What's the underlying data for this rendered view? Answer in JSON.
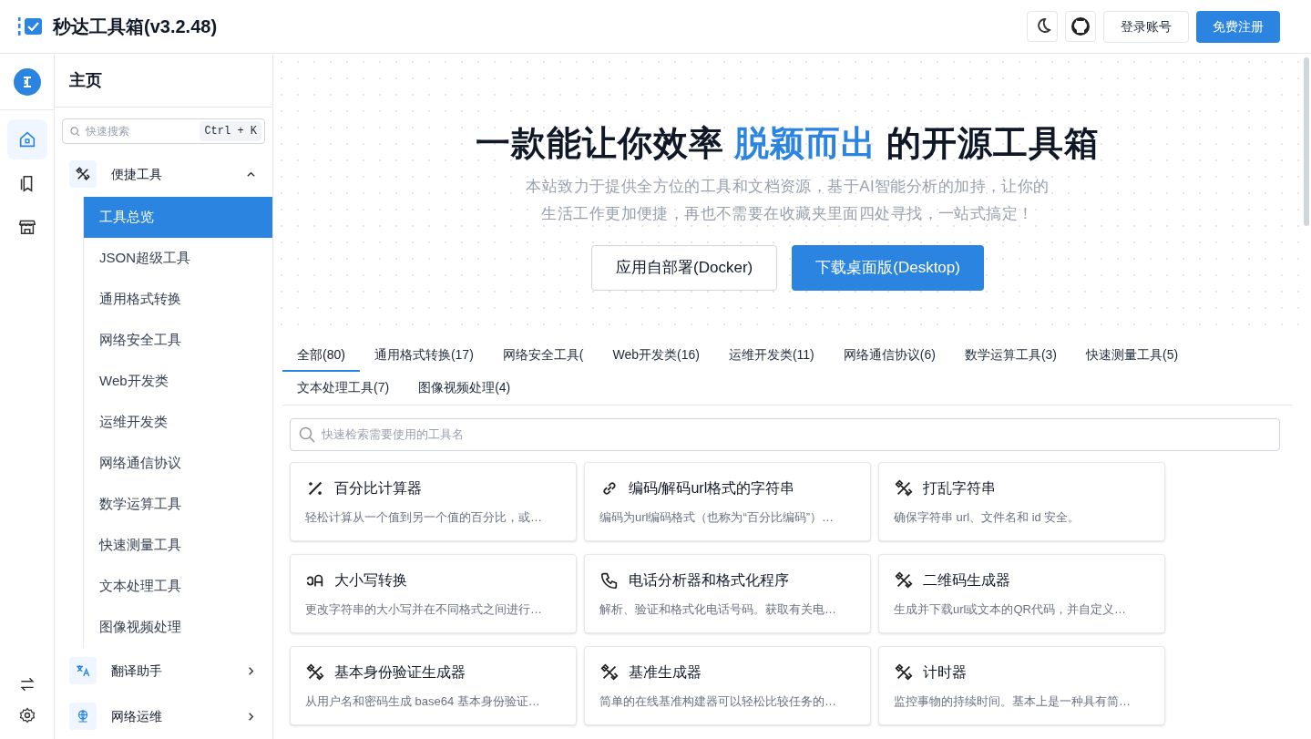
{
  "header": {
    "title": "秒达工具箱(v3.2.48)",
    "buttons": [
      {
        "kind": "theme"
      },
      {
        "kind": "github"
      },
      {
        "kind": "login",
        "label": "登录账号"
      },
      {
        "kind": "signup",
        "label": "免费注册"
      }
    ]
  },
  "rail": {
    "items": [
      {
        "kind": "home",
        "selected": true
      },
      {
        "kind": "bookmark",
        "selected": false
      },
      {
        "kind": "store",
        "selected": false
      }
    ],
    "bottom": [
      {
        "kind": "swap"
      },
      {
        "kind": "settings"
      }
    ]
  },
  "sidebar": {
    "title": "主页",
    "search": {
      "placeholder": "快速搜索",
      "shortcut": "Ctrl + K"
    },
    "groups": [
      {
        "label": "便捷工具",
        "kind": "tools",
        "expanded": true,
        "children": [
          {
            "label": "工具总览",
            "selected": true
          },
          {
            "label": "JSON超级工具",
            "selected": false
          },
          {
            "label": "通用格式转换",
            "selected": false
          },
          {
            "label": "网络安全工具",
            "selected": false
          },
          {
            "label": "Web开发类",
            "selected": false
          },
          {
            "label": "运维开发类",
            "selected": false
          },
          {
            "label": "网络通信协议",
            "selected": false
          },
          {
            "label": "数学运算工具",
            "selected": false
          },
          {
            "label": "快速测量工具",
            "selected": false
          },
          {
            "label": "文本处理工具",
            "selected": false
          },
          {
            "label": "图像视频处理",
            "selected": false
          }
        ]
      },
      {
        "label": "翻译助手",
        "kind": "translate",
        "expanded": false
      },
      {
        "label": "网络运维",
        "kind": "network",
        "expanded": false
      }
    ]
  },
  "hero": {
    "headline_before": "一款能让你效率",
    "headline_highlight": "脱颖而出",
    "headline_after": "的开源工具箱",
    "subtitle_lines": [
      "本站致力于提供全方位的工具和文档资源，基于AI智能分析的加持，让你的",
      "生活工作更加便捷，再也不需要在收藏夹里面四处寻找，一站式搞定！"
    ],
    "buttons": [
      {
        "kind": "outline",
        "label": "应用自部署(Docker)"
      },
      {
        "kind": "primary",
        "label": "下载桌面版(Desktop)"
      }
    ]
  },
  "tabs": [
    {
      "label": "全部(80)",
      "selected": true
    },
    {
      "label": "通用格式转换(17)",
      "selected": false
    },
    {
      "label": "网络安全工具(",
      "selected": false
    },
    {
      "label": "Web开发类(16)",
      "selected": false
    },
    {
      "label": "运维开发类(11)",
      "selected": false
    },
    {
      "label": "网络通信协议(6)",
      "selected": false
    },
    {
      "label": "数学运算工具(3)",
      "selected": false
    },
    {
      "label": "快速测量工具(5)",
      "selected": false
    },
    {
      "label": "文本处理工具(7)",
      "selected": false
    },
    {
      "label": "图像视频处理(4)",
      "selected": false
    }
  ],
  "tool_search": {
    "placeholder": "快速检索需要使用的工具名"
  },
  "tools": [
    {
      "kind": "percent",
      "title": "百分比计算器",
      "description": "轻松计算从一个值到另一个值的百分比，或…"
    },
    {
      "kind": "link",
      "title": "编码/解码url格式的字符串",
      "description": "编码为url编码格式（也称为“百分比编码”）…"
    },
    {
      "kind": "tools",
      "title": "打乱字符串",
      "description": "确保字符串 url、文件名和 id 安全。"
    },
    {
      "kind": "case",
      "title": "大小写转换",
      "description": "更改字符串的大小写并在不同格式之间进行…"
    },
    {
      "kind": "phone",
      "title": "电话分析器和格式化程序",
      "description": "解析、验证和格式化电话号码。获取有关电…"
    },
    {
      "kind": "tools",
      "title": "二维码生成器",
      "description": "生成并下载url或文本的QR代码，并自定义…"
    },
    {
      "kind": "tools",
      "title": "基本身份验证生成器",
      "description": "从用户名和密码生成 base64 基本身份验证…"
    },
    {
      "kind": "tools",
      "title": "基准生成器",
      "description": "简单的在线基准构建器可以轻松比较任务的…"
    },
    {
      "kind": "tools",
      "title": "计时器",
      "description": "监控事物的持续时间。基本上是一种具有简…"
    }
  ]
}
